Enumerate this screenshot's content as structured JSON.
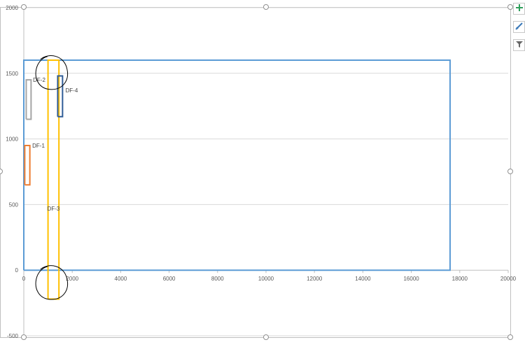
{
  "chart_data": {
    "type": "scatter",
    "title": "",
    "xlabel": "",
    "ylabel": "",
    "xlim": [
      0,
      20000
    ],
    "ylim": [
      -500,
      2000
    ],
    "x_ticks": [
      "0",
      "2000",
      "4000",
      "6000",
      "8000",
      "10000",
      "12000",
      "14000",
      "16000",
      "18000",
      "20000"
    ],
    "y_ticks": [
      "-500",
      "0",
      "500",
      "1000",
      "1500",
      "2000"
    ],
    "grid": "horizontal",
    "legend": "none",
    "series": [
      {
        "color": "#5b9bd5",
        "x": [
          0,
          17600,
          17600,
          0,
          0
        ],
        "y": [
          0,
          0,
          1600,
          1600,
          0
        ]
      },
      {
        "name": "DF-1",
        "color": "#ed7d31",
        "x": [
          40,
          250,
          250,
          40,
          40
        ],
        "y": [
          650,
          650,
          950,
          950,
          650
        ]
      },
      {
        "name": "DF-2",
        "color": "#a5a5a5",
        "x": [
          100,
          300,
          300,
          100,
          100
        ],
        "y": [
          1150,
          1150,
          1450,
          1450,
          1150
        ]
      },
      {
        "name": "DF-3",
        "color": "#ffc000",
        "x": [
          1000,
          1450,
          1450,
          1000,
          1000
        ],
        "y": [
          -220,
          -220,
          1600,
          1600,
          -220
        ]
      },
      {
        "name": "DF-4",
        "color": "#2e5b96",
        "x": [
          1400,
          1600,
          1600,
          1400,
          1400
        ],
        "y": [
          1170,
          1170,
          1480,
          1480,
          1170
        ]
      }
    ],
    "point_labels": [
      {
        "text": "DF-1",
        "x": 350,
        "y": 950
      },
      {
        "text": "DF-2",
        "x": 380,
        "y": 1450
      },
      {
        "text": "DF-3",
        "x": 970,
        "y": 470
      },
      {
        "text": "DF-4",
        "x": 1720,
        "y": 1370
      }
    ],
    "annotations": [
      {
        "shape": "freehand-circle",
        "cx": 1150,
        "cy": 1500
      },
      {
        "shape": "freehand-circle",
        "cx": 1150,
        "cy": -100
      }
    ]
  },
  "side_buttons": [
    {
      "icon": "plus-icon",
      "color": "#2e9e5b"
    },
    {
      "icon": "brush-icon",
      "color": "#3a78b8"
    },
    {
      "icon": "filter-icon",
      "color": "#666666"
    }
  ]
}
